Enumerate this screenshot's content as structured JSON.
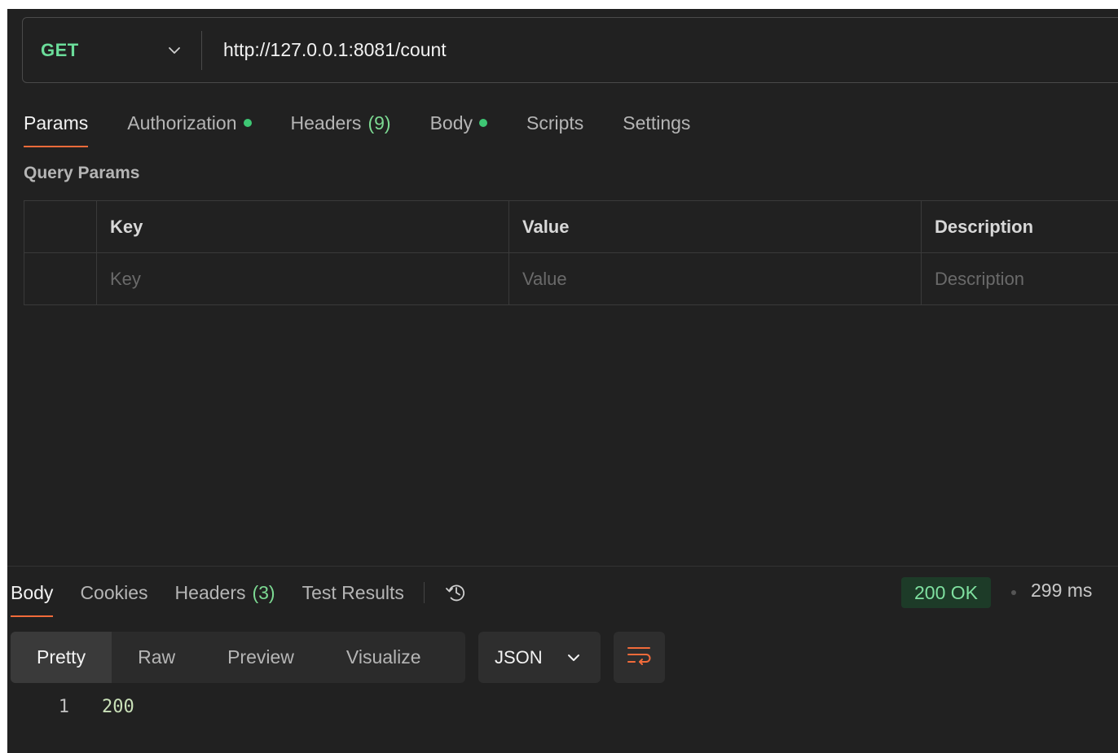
{
  "request": {
    "method": "GET",
    "url": "http://127.0.0.1:8081/count"
  },
  "request_tabs": [
    {
      "label": "Params",
      "active": true
    },
    {
      "label": "Authorization",
      "dot": true
    },
    {
      "label": "Headers",
      "count": "(9)"
    },
    {
      "label": "Body",
      "dot": true
    },
    {
      "label": "Scripts"
    },
    {
      "label": "Settings"
    }
  ],
  "query_params": {
    "title": "Query Params",
    "headers": {
      "key": "Key",
      "value": "Value",
      "description": "Description"
    },
    "placeholders": {
      "key": "Key",
      "value": "Value",
      "description": "Description"
    }
  },
  "response_tabs": [
    {
      "label": "Body",
      "active": true
    },
    {
      "label": "Cookies"
    },
    {
      "label": "Headers",
      "count": "(3)"
    },
    {
      "label": "Test Results"
    }
  ],
  "response_status": {
    "status": "200 OK",
    "time": "299 ms"
  },
  "response_views": [
    {
      "label": "Pretty",
      "active": true
    },
    {
      "label": "Raw"
    },
    {
      "label": "Preview"
    },
    {
      "label": "Visualize"
    }
  ],
  "response_format": "JSON",
  "response_body": [
    {
      "line": "1",
      "value": "200"
    }
  ],
  "colors": {
    "method": "#6bdd9a",
    "accent": "#f26b3a",
    "status_bg": "#1d3b28",
    "status_text": "#7fe0a0"
  },
  "icons": {
    "method_dropdown": "chevron-down-icon",
    "history": "history-icon",
    "format_dropdown": "chevron-down-icon",
    "wrap": "wrap-lines-icon"
  }
}
